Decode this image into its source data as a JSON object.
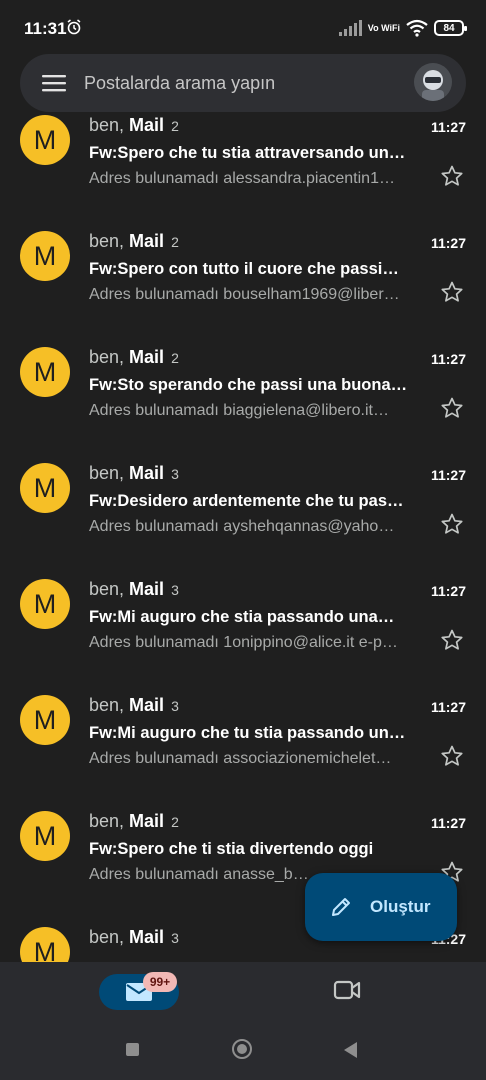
{
  "status_bar": {
    "time": "11:31",
    "network_label": "Vo WiFi",
    "battery": "84"
  },
  "search": {
    "placeholder": "Postalarda arama yapın"
  },
  "emails": [
    {
      "avatar_letter": "M",
      "sender_prefix": "ben, ",
      "sender_name": "Mail",
      "count": "2",
      "time": "11:27",
      "subject": "Fw:Spero che tu stia attraversando un…",
      "snippet": "Adres bulunamadı alessandra.piacentin1…"
    },
    {
      "avatar_letter": "M",
      "sender_prefix": "ben, ",
      "sender_name": "Mail",
      "count": "2",
      "time": "11:27",
      "subject": "Fw:Spero con tutto il cuore che passi…",
      "snippet": "Adres bulunamadı bouselham1969@liber…"
    },
    {
      "avatar_letter": "M",
      "sender_prefix": "ben, ",
      "sender_name": "Mail",
      "count": "2",
      "time": "11:27",
      "subject": "Fw:Sto sperando che passi una buona…",
      "snippet": "Adres bulunamadı biaggielena@libero.it…"
    },
    {
      "avatar_letter": "M",
      "sender_prefix": "ben, ",
      "sender_name": "Mail",
      "count": "3",
      "time": "11:27",
      "subject": "Fw:Desidero ardentemente che tu pas…",
      "snippet": "Adres bulunamadı ayshehqannas@yaho…"
    },
    {
      "avatar_letter": "M",
      "sender_prefix": "ben, ",
      "sender_name": "Mail",
      "count": "3",
      "time": "11:27",
      "subject": "Fw:Mi auguro che stia passando una…",
      "snippet": "Adres bulunamadı 1onippino@alice.it e-p…"
    },
    {
      "avatar_letter": "M",
      "sender_prefix": "ben, ",
      "sender_name": "Mail",
      "count": "3",
      "time": "11:27",
      "subject": "Fw:Mi auguro che tu stia passando un…",
      "snippet": "Adres bulunamadı associazionemichelet…"
    },
    {
      "avatar_letter": "M",
      "sender_prefix": "ben, ",
      "sender_name": "Mail",
      "count": "2",
      "time": "11:27",
      "subject": "Fw:Spero che ti stia divertendo oggi",
      "snippet": "Adres bulunamadı anasse_b…"
    },
    {
      "avatar_letter": "M",
      "sender_prefix": "ben, ",
      "sender_name": "Mail",
      "count": "3",
      "time": "11:27",
      "subject": "",
      "snippet": ""
    }
  ],
  "fab": {
    "label": "Oluştur",
    "icon": "pencil-icon"
  },
  "bottom_nav": {
    "mail_badge": "99+",
    "mail_icon": "mail-icon",
    "video_icon": "video-camera-icon"
  },
  "colors": {
    "background": "#1f1f1f",
    "avatar": "#f6bf26",
    "fab": "#004a77",
    "fab_text": "#c2e7ff",
    "badge": "#f2b8b5"
  }
}
